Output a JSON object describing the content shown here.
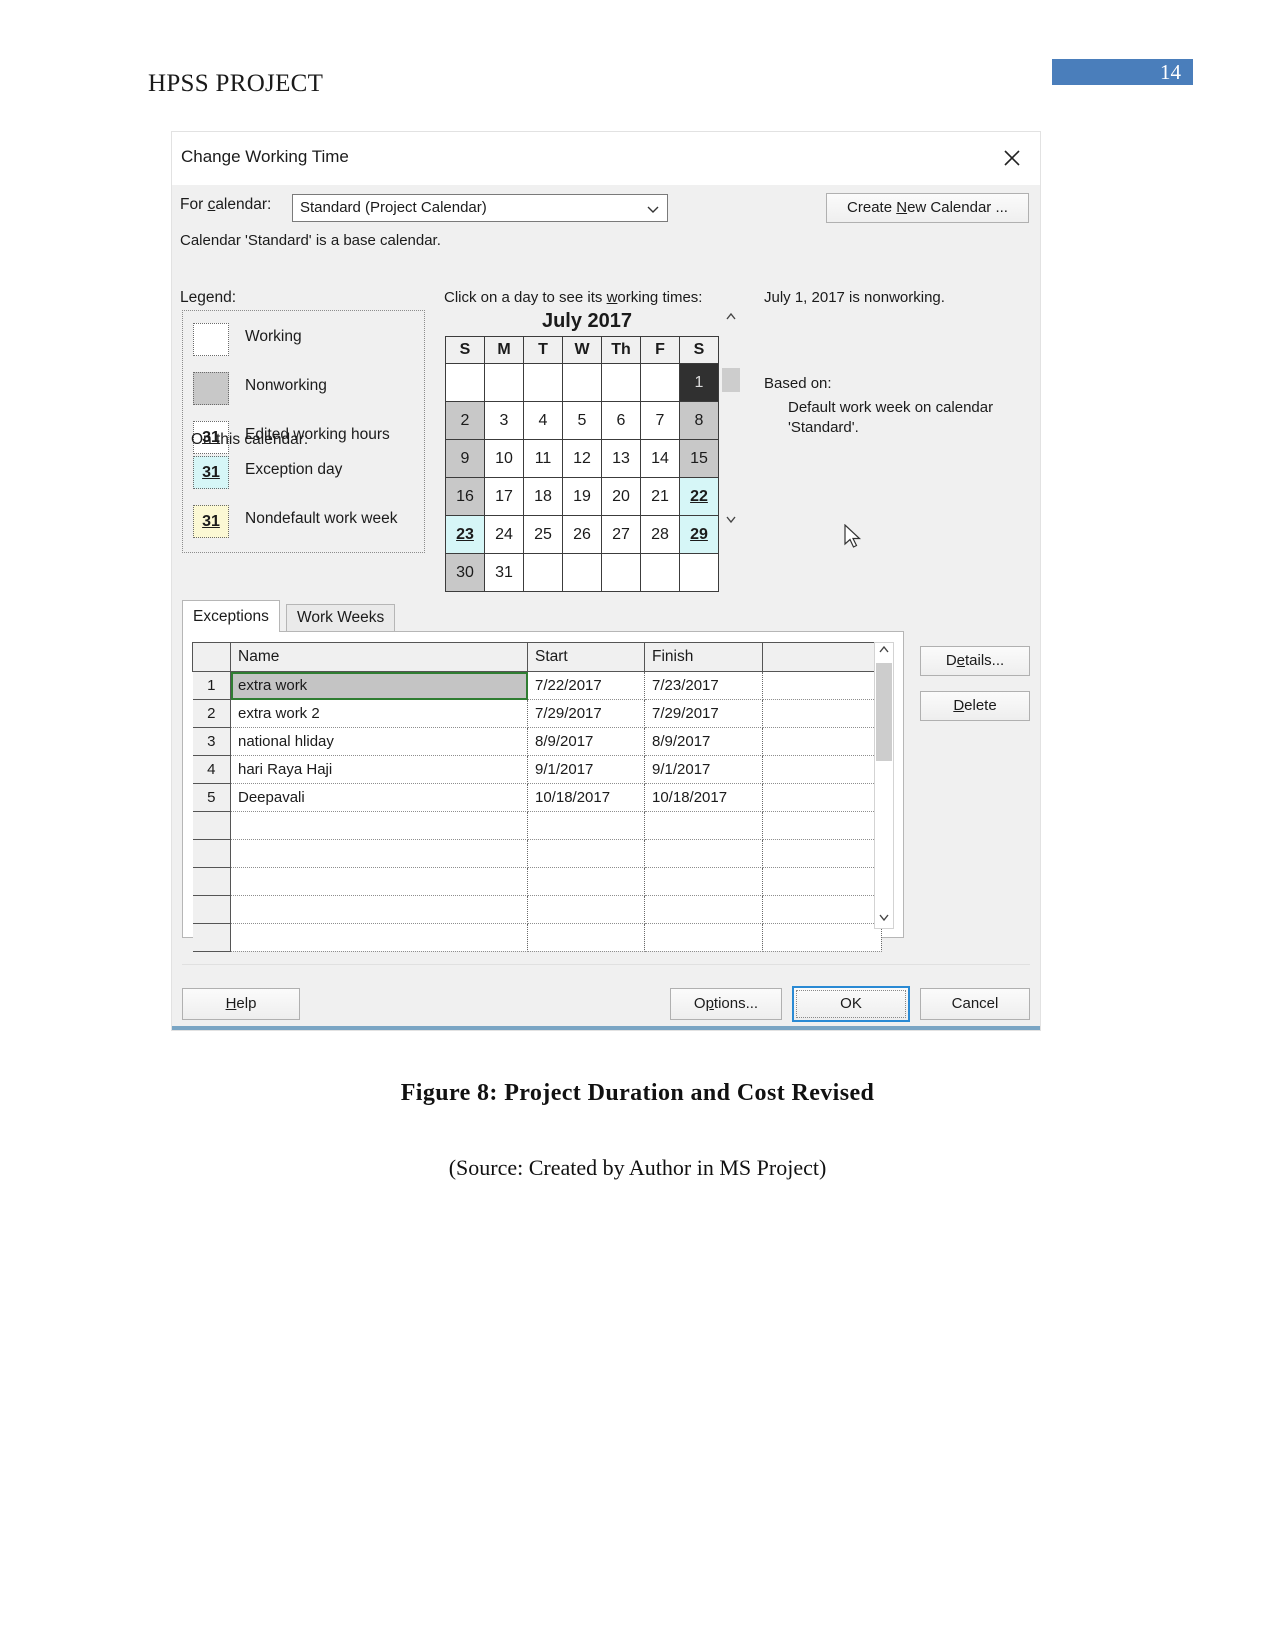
{
  "document": {
    "header_title": "HPSS PROJECT",
    "page_number": "14",
    "accent_color": "#4a7ebb",
    "figure_caption": "Figure 8: Project Duration and Cost Revised",
    "figure_source": "(Source: Created by Author in MS Project)"
  },
  "dialog": {
    "title": "Change Working Time",
    "close_icon": "close-icon",
    "for_calendar_label": "For calendar:",
    "calendar_select_value": "Standard (Project Calendar)",
    "calendar_select_chevron": "chevron-down-icon",
    "create_new_calendar_label": "Create New Calendar ...",
    "base_calendar_note": "Calendar 'Standard' is a base calendar."
  },
  "legend": {
    "heading": "Legend:",
    "on_this_calendar_heading": "On this calendar:",
    "items": [
      {
        "label": "Working",
        "swatch": "",
        "style": "working"
      },
      {
        "label": "Nonworking",
        "swatch": "",
        "style": "nonworking"
      },
      {
        "label": "Edited working hours",
        "swatch": "31",
        "style": "edited"
      }
    ],
    "calendar_items": [
      {
        "label": "Exception day",
        "swatch": "31",
        "style": "exception"
      },
      {
        "label": "Nondefault work week",
        "swatch": "31",
        "style": "nondefault"
      }
    ]
  },
  "calendar": {
    "hint": "Click on a day to see its working times:",
    "month_title": "July 2017",
    "day_headers": [
      "S",
      "M",
      "T",
      "W",
      "Th",
      "F",
      "S"
    ],
    "weeks": [
      [
        {
          "d": "",
          "t": "empty"
        },
        {
          "d": "",
          "t": "empty"
        },
        {
          "d": "",
          "t": "empty"
        },
        {
          "d": "",
          "t": "empty"
        },
        {
          "d": "",
          "t": "empty"
        },
        {
          "d": "",
          "t": "empty"
        },
        {
          "d": "1",
          "t": "selected"
        }
      ],
      [
        {
          "d": "2",
          "t": "weekend"
        },
        {
          "d": "3",
          "t": "work"
        },
        {
          "d": "4",
          "t": "work"
        },
        {
          "d": "5",
          "t": "work"
        },
        {
          "d": "6",
          "t": "work"
        },
        {
          "d": "7",
          "t": "work"
        },
        {
          "d": "8",
          "t": "weekend"
        }
      ],
      [
        {
          "d": "9",
          "t": "weekend"
        },
        {
          "d": "10",
          "t": "work"
        },
        {
          "d": "11",
          "t": "work"
        },
        {
          "d": "12",
          "t": "work"
        },
        {
          "d": "13",
          "t": "work"
        },
        {
          "d": "14",
          "t": "work"
        },
        {
          "d": "15",
          "t": "weekend"
        }
      ],
      [
        {
          "d": "16",
          "t": "weekend"
        },
        {
          "d": "17",
          "t": "work"
        },
        {
          "d": "18",
          "t": "work"
        },
        {
          "d": "19",
          "t": "work"
        },
        {
          "d": "20",
          "t": "work"
        },
        {
          "d": "21",
          "t": "work"
        },
        {
          "d": "22",
          "t": "exception"
        }
      ],
      [
        {
          "d": "23",
          "t": "exception"
        },
        {
          "d": "24",
          "t": "work"
        },
        {
          "d": "25",
          "t": "work"
        },
        {
          "d": "26",
          "t": "work"
        },
        {
          "d": "27",
          "t": "work"
        },
        {
          "d": "28",
          "t": "work"
        },
        {
          "d": "29",
          "t": "exception"
        }
      ],
      [
        {
          "d": "30",
          "t": "weekend"
        },
        {
          "d": "31",
          "t": "work"
        },
        {
          "d": "",
          "t": "empty"
        },
        {
          "d": "",
          "t": "empty"
        },
        {
          "d": "",
          "t": "empty"
        },
        {
          "d": "",
          "t": "empty"
        },
        {
          "d": "",
          "t": "empty"
        }
      ]
    ],
    "scroll_up_icon": "chevron-up-icon",
    "scroll_down_icon": "chevron-down-icon"
  },
  "info_panel": {
    "day_status": "July 1, 2017 is nonworking.",
    "based_on_label": "Based on:",
    "based_on_value": "Default work week on calendar 'Standard'."
  },
  "tabs": [
    {
      "label": "Exceptions",
      "active": true
    },
    {
      "label": "Work Weeks",
      "active": false
    }
  ],
  "exceptions_table": {
    "columns": [
      "",
      "Name",
      "Start",
      "Finish",
      ""
    ],
    "rows": [
      {
        "idx": "1",
        "name": "extra work",
        "start": "7/22/2017",
        "finish": "7/23/2017",
        "selected": true
      },
      {
        "idx": "2",
        "name": "extra work 2",
        "start": "7/29/2017",
        "finish": "7/29/2017",
        "selected": false
      },
      {
        "idx": "3",
        "name": "national hliday",
        "start": "8/9/2017",
        "finish": "8/9/2017",
        "selected": false
      },
      {
        "idx": "4",
        "name": "hari Raya Haji",
        "start": "9/1/2017",
        "finish": "9/1/2017",
        "selected": false
      },
      {
        "idx": "5",
        "name": "Deepavali",
        "start": "10/18/2017",
        "finish": "10/18/2017",
        "selected": false
      },
      {
        "idx": "",
        "name": "",
        "start": "",
        "finish": "",
        "selected": false
      },
      {
        "idx": "",
        "name": "",
        "start": "",
        "finish": "",
        "selected": false
      },
      {
        "idx": "",
        "name": "",
        "start": "",
        "finish": "",
        "selected": false
      },
      {
        "idx": "",
        "name": "",
        "start": "",
        "finish": "",
        "selected": false
      },
      {
        "idx": "",
        "name": "",
        "start": "",
        "finish": "",
        "selected": false
      }
    ]
  },
  "side_buttons": {
    "details_label": "Details...",
    "delete_label": "Delete"
  },
  "footer_buttons": {
    "help_label": "Help",
    "options_label": "Options...",
    "ok_label": "OK",
    "cancel_label": "Cancel"
  }
}
